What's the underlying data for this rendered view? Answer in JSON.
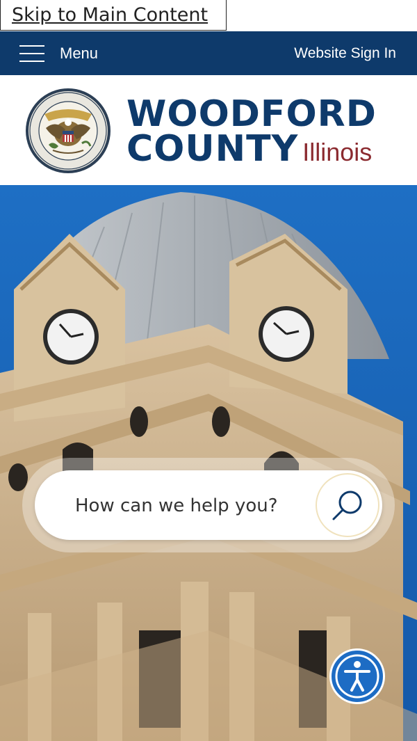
{
  "skip_link": "Skip to Main Content",
  "topbar": {
    "menu_label": "Menu",
    "signin_label": "Website Sign In",
    "background": "#0e3a6b"
  },
  "brand": {
    "line1": "WOODFORD",
    "line2": "COUNTY",
    "state": "Illinois",
    "primary_color": "#0e3a6b",
    "state_color": "#8b2a2f"
  },
  "search": {
    "placeholder": "How can we help you?"
  },
  "icons": {
    "menu": "hamburger-icon",
    "search": "search-icon",
    "accessibility": "accessibility-icon"
  }
}
